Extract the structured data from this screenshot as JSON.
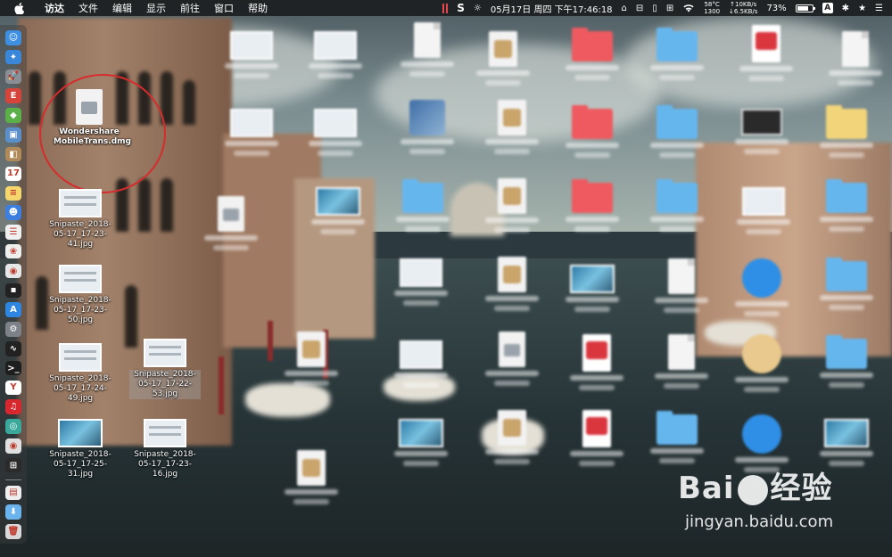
{
  "menubar": {
    "app_name": "访达",
    "menus": [
      "文件",
      "编辑",
      "显示",
      "前往",
      "窗口",
      "帮助"
    ],
    "status": {
      "s_icon_label": "S",
      "datetime": "05月17日 周四 下午17:46:18",
      "cpu_temp": "58°C",
      "fan_rpm": "1300",
      "net_up": "↑10KB/s",
      "net_down": "↓6.5KB/s",
      "battery_percent": "73%",
      "battery_level": 0.73,
      "ime_label": "A"
    }
  },
  "dock": {
    "items": [
      {
        "name": "finder",
        "color": "#3e8fe0",
        "glyph": "☺"
      },
      {
        "name": "safari",
        "color": "#3a87d9",
        "glyph": "✦"
      },
      {
        "name": "launchpad",
        "color": "#8a8f96",
        "glyph": "🚀"
      },
      {
        "name": "app-red",
        "color": "#d6453b",
        "glyph": "E"
      },
      {
        "name": "android",
        "color": "#5bb04a",
        "glyph": "◆"
      },
      {
        "name": "preview",
        "color": "#5a8fc9",
        "glyph": "▣"
      },
      {
        "name": "app-brown",
        "color": "#b08a58",
        "glyph": "◧"
      },
      {
        "name": "calendar",
        "color": "#ffffff",
        "glyph": "17"
      },
      {
        "name": "notes",
        "color": "#f5d76e",
        "glyph": "≡"
      },
      {
        "name": "contacts",
        "color": "#3c7fe0",
        "glyph": "☻"
      },
      {
        "name": "reminders",
        "color": "#f0f0f0",
        "glyph": "☰"
      },
      {
        "name": "photos-app",
        "color": "#eeeeee",
        "glyph": "❀"
      },
      {
        "name": "chrome",
        "color": "#e7e7e7",
        "glyph": "◉"
      },
      {
        "name": "terminal-green",
        "color": "#222222",
        "glyph": "▪"
      },
      {
        "name": "app-store",
        "color": "#2f86e0",
        "glyph": "A"
      },
      {
        "name": "system-preferences",
        "color": "#7d8288",
        "glyph": "⚙"
      },
      {
        "name": "activity-monitor",
        "color": "#222222",
        "glyph": "∿"
      },
      {
        "name": "terminal",
        "color": "#1e1e1e",
        "glyph": ">_"
      },
      {
        "name": "yandex",
        "color": "#ffffff",
        "glyph": "Y"
      },
      {
        "name": "netease-music",
        "color": "#d8282f",
        "glyph": "♫"
      },
      {
        "name": "app-teal",
        "color": "#3aa89b",
        "glyph": "◎"
      },
      {
        "name": "app-camera",
        "color": "#e0e0e0",
        "glyph": "◉"
      },
      {
        "name": "windows",
        "color": "#2b2b2b",
        "glyph": "⊞"
      }
    ],
    "trailing": [
      {
        "name": "document-stack",
        "color": "#eeeeee",
        "glyph": "▤"
      },
      {
        "name": "downloads-folder",
        "color": "#6ab3ec",
        "glyph": "⬇"
      },
      {
        "name": "trash",
        "color": "#d8d8d8",
        "glyph": "🗑"
      }
    ]
  },
  "desktop": {
    "highlighted": {
      "label": "Wondershare MobileTrans.dmg"
    },
    "items": [
      {
        "label": "Snipaste_2018-05-17_17-23-41.jpg",
        "icon": "screenshot"
      },
      {
        "label": "Snipaste_2018-05-17_17-23-50.jpg",
        "icon": "screenshot"
      },
      {
        "label": "Snipaste_2018-05-17_17-24-49.jpg",
        "icon": "screenshot"
      },
      {
        "label": "Snipaste_2018-05-17_17-22-53.jpg",
        "icon": "screenshot"
      },
      {
        "label": "Snipaste_2018-05-17_17-25-31.jpg",
        "icon": "photo"
      },
      {
        "label": "Snipaste_2018-05-17_17-23-16.jpg",
        "icon": "screenshot"
      }
    ],
    "blurred_label": "",
    "watermark": {
      "logo_left": "Bai",
      "logo_right": "经验",
      "url": "jingyan.baidu.com"
    }
  }
}
